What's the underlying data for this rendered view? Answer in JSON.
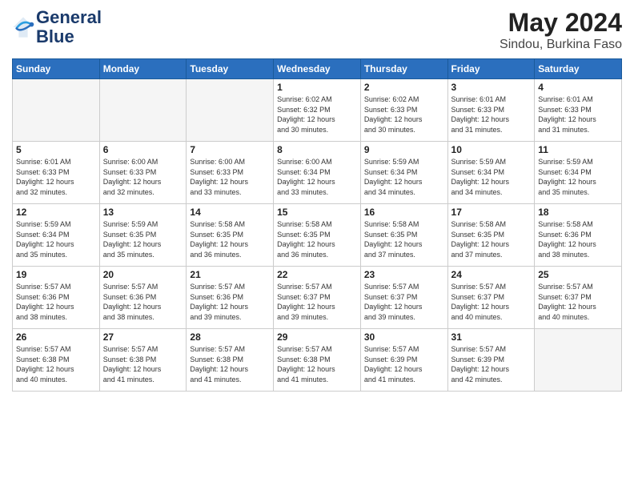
{
  "header": {
    "logo_line1": "General",
    "logo_line2": "Blue",
    "month_title": "May 2024",
    "subtitle": "Sindou, Burkina Faso"
  },
  "weekdays": [
    "Sunday",
    "Monday",
    "Tuesday",
    "Wednesday",
    "Thursday",
    "Friday",
    "Saturday"
  ],
  "weeks": [
    [
      {
        "day": "",
        "info": ""
      },
      {
        "day": "",
        "info": ""
      },
      {
        "day": "",
        "info": ""
      },
      {
        "day": "1",
        "info": "Sunrise: 6:02 AM\nSunset: 6:32 PM\nDaylight: 12 hours\nand 30 minutes."
      },
      {
        "day": "2",
        "info": "Sunrise: 6:02 AM\nSunset: 6:33 PM\nDaylight: 12 hours\nand 30 minutes."
      },
      {
        "day": "3",
        "info": "Sunrise: 6:01 AM\nSunset: 6:33 PM\nDaylight: 12 hours\nand 31 minutes."
      },
      {
        "day": "4",
        "info": "Sunrise: 6:01 AM\nSunset: 6:33 PM\nDaylight: 12 hours\nand 31 minutes."
      }
    ],
    [
      {
        "day": "5",
        "info": "Sunrise: 6:01 AM\nSunset: 6:33 PM\nDaylight: 12 hours\nand 32 minutes."
      },
      {
        "day": "6",
        "info": "Sunrise: 6:00 AM\nSunset: 6:33 PM\nDaylight: 12 hours\nand 32 minutes."
      },
      {
        "day": "7",
        "info": "Sunrise: 6:00 AM\nSunset: 6:33 PM\nDaylight: 12 hours\nand 33 minutes."
      },
      {
        "day": "8",
        "info": "Sunrise: 6:00 AM\nSunset: 6:34 PM\nDaylight: 12 hours\nand 33 minutes."
      },
      {
        "day": "9",
        "info": "Sunrise: 5:59 AM\nSunset: 6:34 PM\nDaylight: 12 hours\nand 34 minutes."
      },
      {
        "day": "10",
        "info": "Sunrise: 5:59 AM\nSunset: 6:34 PM\nDaylight: 12 hours\nand 34 minutes."
      },
      {
        "day": "11",
        "info": "Sunrise: 5:59 AM\nSunset: 6:34 PM\nDaylight: 12 hours\nand 35 minutes."
      }
    ],
    [
      {
        "day": "12",
        "info": "Sunrise: 5:59 AM\nSunset: 6:34 PM\nDaylight: 12 hours\nand 35 minutes."
      },
      {
        "day": "13",
        "info": "Sunrise: 5:59 AM\nSunset: 6:35 PM\nDaylight: 12 hours\nand 35 minutes."
      },
      {
        "day": "14",
        "info": "Sunrise: 5:58 AM\nSunset: 6:35 PM\nDaylight: 12 hours\nand 36 minutes."
      },
      {
        "day": "15",
        "info": "Sunrise: 5:58 AM\nSunset: 6:35 PM\nDaylight: 12 hours\nand 36 minutes."
      },
      {
        "day": "16",
        "info": "Sunrise: 5:58 AM\nSunset: 6:35 PM\nDaylight: 12 hours\nand 37 minutes."
      },
      {
        "day": "17",
        "info": "Sunrise: 5:58 AM\nSunset: 6:35 PM\nDaylight: 12 hours\nand 37 minutes."
      },
      {
        "day": "18",
        "info": "Sunrise: 5:58 AM\nSunset: 6:36 PM\nDaylight: 12 hours\nand 38 minutes."
      }
    ],
    [
      {
        "day": "19",
        "info": "Sunrise: 5:57 AM\nSunset: 6:36 PM\nDaylight: 12 hours\nand 38 minutes."
      },
      {
        "day": "20",
        "info": "Sunrise: 5:57 AM\nSunset: 6:36 PM\nDaylight: 12 hours\nand 38 minutes."
      },
      {
        "day": "21",
        "info": "Sunrise: 5:57 AM\nSunset: 6:36 PM\nDaylight: 12 hours\nand 39 minutes."
      },
      {
        "day": "22",
        "info": "Sunrise: 5:57 AM\nSunset: 6:37 PM\nDaylight: 12 hours\nand 39 minutes."
      },
      {
        "day": "23",
        "info": "Sunrise: 5:57 AM\nSunset: 6:37 PM\nDaylight: 12 hours\nand 39 minutes."
      },
      {
        "day": "24",
        "info": "Sunrise: 5:57 AM\nSunset: 6:37 PM\nDaylight: 12 hours\nand 40 minutes."
      },
      {
        "day": "25",
        "info": "Sunrise: 5:57 AM\nSunset: 6:37 PM\nDaylight: 12 hours\nand 40 minutes."
      }
    ],
    [
      {
        "day": "26",
        "info": "Sunrise: 5:57 AM\nSunset: 6:38 PM\nDaylight: 12 hours\nand 40 minutes."
      },
      {
        "day": "27",
        "info": "Sunrise: 5:57 AM\nSunset: 6:38 PM\nDaylight: 12 hours\nand 41 minutes."
      },
      {
        "day": "28",
        "info": "Sunrise: 5:57 AM\nSunset: 6:38 PM\nDaylight: 12 hours\nand 41 minutes."
      },
      {
        "day": "29",
        "info": "Sunrise: 5:57 AM\nSunset: 6:38 PM\nDaylight: 12 hours\nand 41 minutes."
      },
      {
        "day": "30",
        "info": "Sunrise: 5:57 AM\nSunset: 6:39 PM\nDaylight: 12 hours\nand 41 minutes."
      },
      {
        "day": "31",
        "info": "Sunrise: 5:57 AM\nSunset: 6:39 PM\nDaylight: 12 hours\nand 42 minutes."
      },
      {
        "day": "",
        "info": ""
      }
    ]
  ]
}
